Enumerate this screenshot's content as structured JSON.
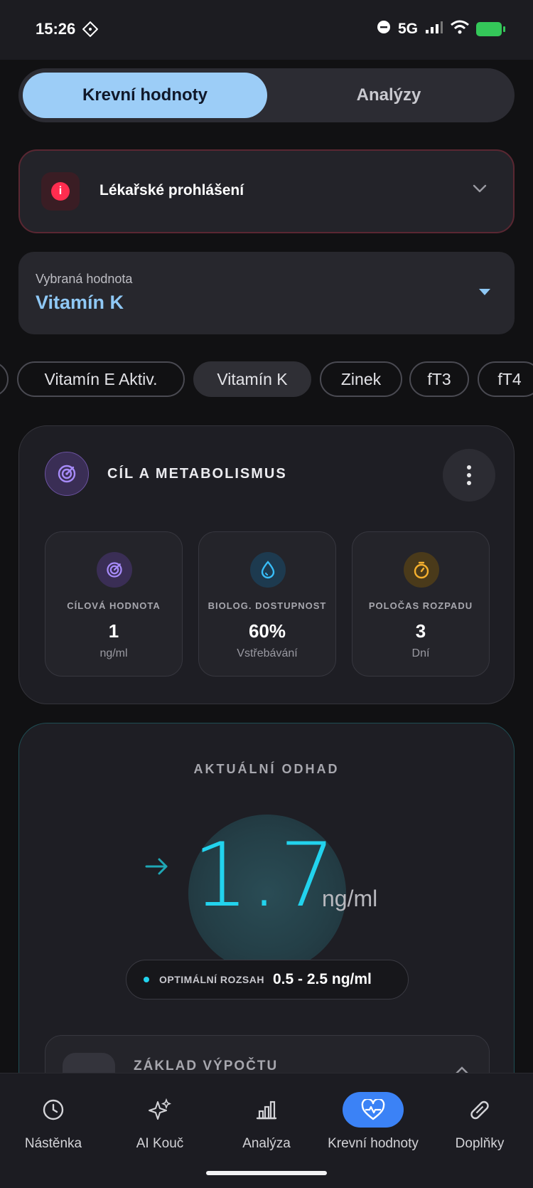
{
  "status_bar": {
    "time": "15:26",
    "network": "5G"
  },
  "segmented": {
    "active": "Krevní hodnoty",
    "inactive": "Analýzy"
  },
  "disclaimer": {
    "title": "Lékařské prohlášení"
  },
  "selector": {
    "label": "Vybraná hodnota",
    "value": "Vitamín K"
  },
  "chips": [
    "Vitamín E Aktiv.",
    "Vitamín K",
    "Zinek",
    "fT3",
    "fT4"
  ],
  "active_chip": "Vitamín K",
  "meta_card": {
    "title": "CÍL A METABOLISMUS",
    "stats": [
      {
        "label": "CÍLOVÁ HODNOTA",
        "value": "1",
        "unit": "ng/ml",
        "icon": "target-icon",
        "color": "#a78bfa"
      },
      {
        "label": "BIOLOG. DOSTUPNOST",
        "value": "60%",
        "unit": "Vstřebávání",
        "icon": "droplet-icon",
        "color": "#38bdf8"
      },
      {
        "label": "POLOČAS ROZPADU",
        "value": "3",
        "unit": "Dní",
        "icon": "stopwatch-icon",
        "color": "#f5b02e"
      }
    ]
  },
  "estimate_card": {
    "title": "AKTUÁLNÍ ODHAD",
    "value": "1.7",
    "unit": "ng/ml",
    "range_label": "OPTIMÁLNÍ ROZSAH",
    "range_value": "0.5 - 2.5 ng/ml",
    "basis_title": "ZÁKLAD VÝPOČTU"
  },
  "tabbar": {
    "items": [
      "Nástěnka",
      "AI Kouč",
      "Analýza",
      "Krevní hodnoty",
      "Doplňky"
    ],
    "active": "Krevní hodnoty"
  },
  "colors": {
    "accent": "#22d3ee",
    "primary": "#3b82f6",
    "segment_active": "#9ccdf7",
    "danger": "#ff2d4f"
  }
}
